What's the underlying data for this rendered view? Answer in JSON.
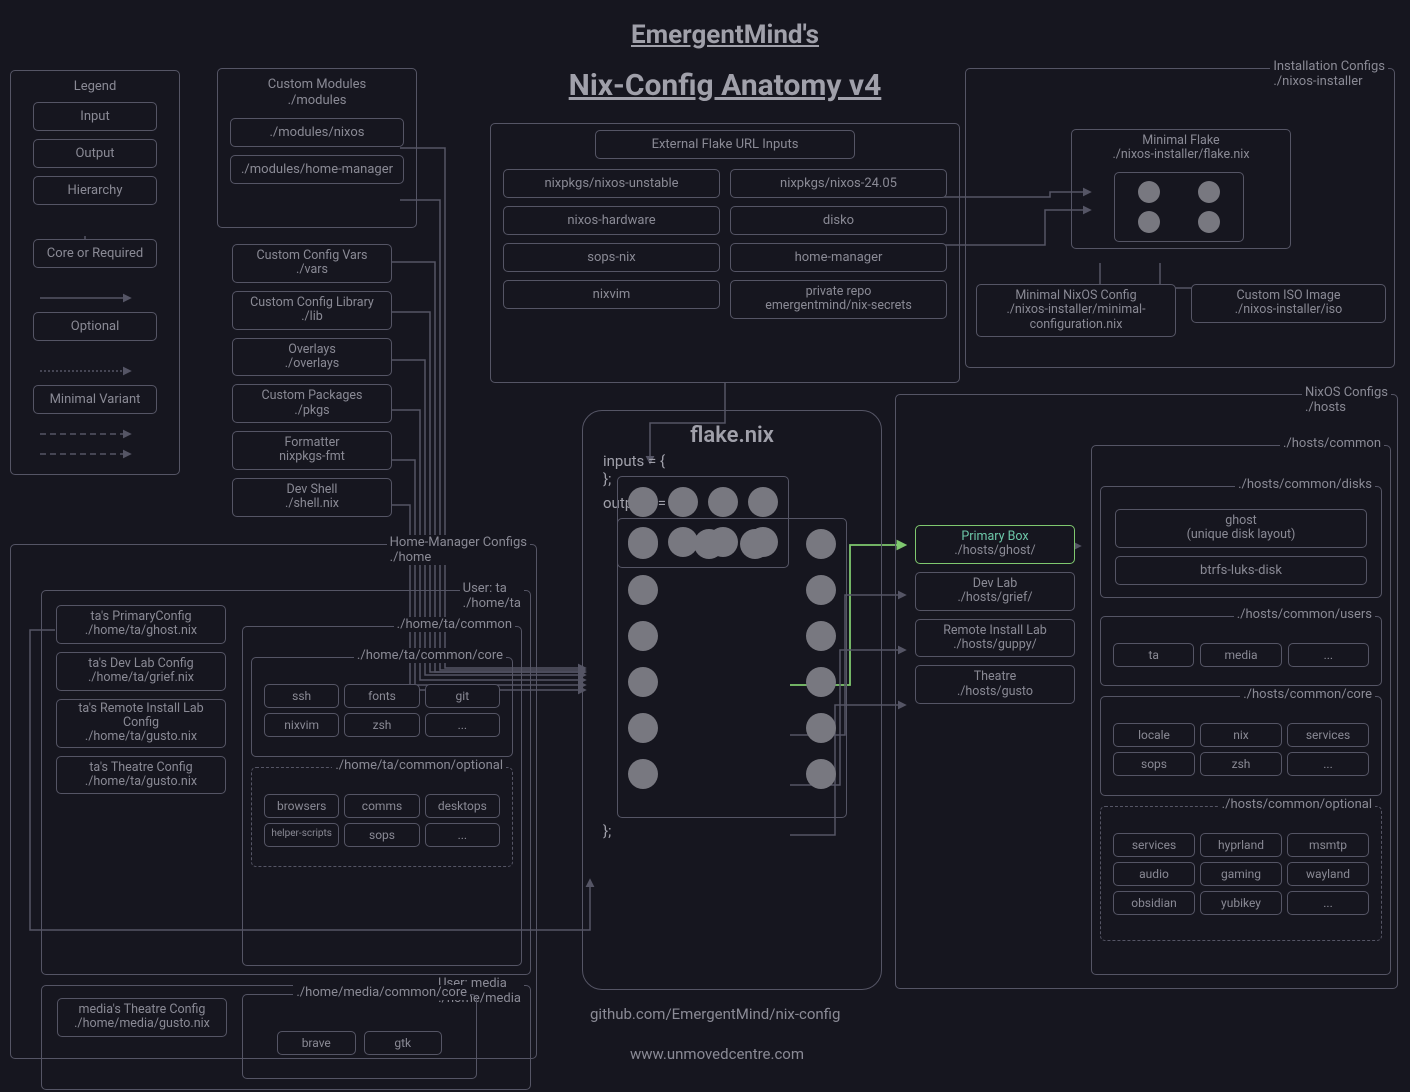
{
  "title1": "EmergentMind's",
  "title2": "Nix-Config Anatomy v4",
  "legend": {
    "title": "Legend",
    "input": "Input",
    "output": "Output",
    "hierarchy": "Hierarchy",
    "core": "Core or Required",
    "optional": "Optional",
    "minimal": "Minimal Variant"
  },
  "modules": {
    "title": "Custom Modules",
    "path": "./modules",
    "nixos": "./modules/nixos",
    "hm": "./modules/home-manager"
  },
  "side": {
    "vars": {
      "t": "Custom Config Vars",
      "p": "./vars"
    },
    "lib": {
      "t": "Custom Config Library",
      "p": "./lib"
    },
    "overlays": {
      "t": "Overlays",
      "p": "./overlays"
    },
    "pkgs": {
      "t": "Custom Packages",
      "p": "./pkgs"
    },
    "fmt": {
      "t": "Formatter",
      "p": "nixpkgs-fmt"
    },
    "shell": {
      "t": "Dev Shell",
      "p": "./shell.nix"
    }
  },
  "ext": {
    "title": "External Flake URL Inputs",
    "c1": [
      "nixpkgs/nixos-unstable",
      "nixos-hardware",
      "sops-nix",
      "nixvim"
    ],
    "c2a": "nixpkgs/nixos-24.05",
    "c2b": "disko",
    "c2c": "home-manager",
    "c2d": {
      "t": "private repo",
      "p": "emergentmind/nix-secrets"
    }
  },
  "install": {
    "title": "Installation Configs",
    "path": "./nixos-installer",
    "mf": {
      "t": "Minimal Flake",
      "p": "./nixos-installer/flake.nix"
    },
    "mn": {
      "t": "Minimal NixOS Config",
      "p": "./nixos-installer/minimal-configuration.nix"
    },
    "iso": {
      "t": "Custom ISO Image",
      "p": "./nixos-installer/iso"
    }
  },
  "flake": {
    "title": "flake.nix",
    "inputs": "inputs = {",
    "outputs": "outputs = {",
    "close": "};"
  },
  "hosts": {
    "primary": {
      "t": "Primary Box",
      "p": "./hosts/ghost/"
    },
    "dev": {
      "t": "Dev Lab",
      "p": "./hosts/grief/"
    },
    "remote": {
      "t": "Remote Install Lab",
      "p": "./hosts/guppy/"
    },
    "theatre": {
      "t": "Theatre",
      "p": "./hosts/gusto"
    }
  },
  "nixos": {
    "title": "NixOS Configs",
    "path": "./hosts",
    "common": "./hosts/common",
    "disks": {
      "title": "./hosts/common/disks",
      "ghost": {
        "t": "ghost",
        "p": "(unique disk layout)"
      },
      "btrfs": "btrfs-luks-disk"
    },
    "users": {
      "title": "./hosts/common/users",
      "items": [
        "ta",
        "media",
        "..."
      ]
    },
    "core": {
      "title": "./hosts/common/core",
      "items": [
        "locale",
        "nix",
        "services",
        "sops",
        "zsh",
        "..."
      ]
    },
    "optional": {
      "title": "./hosts/common/optional",
      "items": [
        "services",
        "hyprland",
        "msmtp",
        "audio",
        "gaming",
        "wayland",
        "obsidian",
        "yubikey",
        "..."
      ]
    }
  },
  "hm": {
    "title": "Home-Manager Configs",
    "path": "./home",
    "userta": {
      "t": "User: ta",
      "p": "./home/ta"
    },
    "usermedia": {
      "t": "User: media",
      "p": "./home/media"
    },
    "cfg": {
      "primary": {
        "t": "ta's PrimaryConfig",
        "p": "./home/ta/ghost.nix"
      },
      "dev": {
        "t": "ta's Dev Lab Config",
        "p": "./home/ta/grief.nix"
      },
      "remote": {
        "t": "ta's Remote Install Lab Config",
        "p": "./home/ta/gusto.nix"
      },
      "theatre": {
        "t": "ta's Theatre Config",
        "p": "./home/ta/gusto.nix"
      },
      "media": {
        "t": "media's Theatre Config",
        "p": "./home/media/gusto.nix"
      }
    },
    "tacommon": "./home/ta/common",
    "tacore": {
      "title": "./home/ta/common/core",
      "items": [
        "ssh",
        "fonts",
        "git",
        "nixvim",
        "zsh",
        "..."
      ]
    },
    "taoptional": {
      "title": "./home/ta/common/optional",
      "items": [
        "browsers",
        "comms",
        "desktops",
        "helper-scripts",
        "sops",
        "..."
      ]
    },
    "mediacore": {
      "title": "./home/media/common/core",
      "items": [
        "brave",
        "gtk"
      ]
    }
  },
  "footer": {
    "gh": "github.com/EmergentMind/nix-config",
    "site": "www.unmovedcentre.com"
  }
}
